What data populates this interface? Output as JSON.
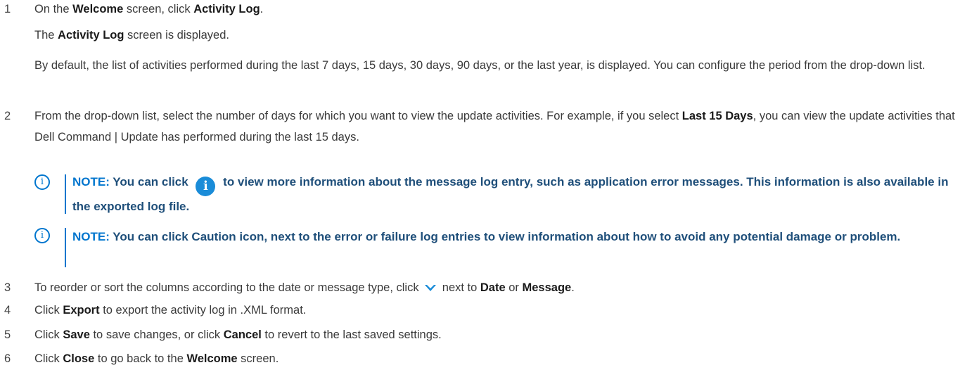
{
  "step1": {
    "num": "1",
    "pre": "On the ",
    "b1": "Welcome",
    "mid": " screen, click ",
    "b2": "Activity Log",
    "post": ".",
    "result_b": "Activity Log",
    "result_post": " screen is displayed.",
    "result_pre": "The ",
    "default_text": "By default, the list of activities performed during the last 7 days, 15 days, 30 days, 90 days, or the last year, is displayed. You can configure the period from the drop-down list."
  },
  "step2": {
    "num": "2",
    "pre": "From the drop-down list, select the number of days for which you want to view the update activities. For example, if you select ",
    "b": "Last 15 Days",
    "post": ", you can view the update activities that Dell Command | Update has performed during the last 15 days."
  },
  "note1": {
    "label": "NOTE:",
    "pre": " You can click ",
    "post": " to view more information about the message log entry, such as application error messages. This information is also available in the exported log file.",
    "icon_glyph": "i"
  },
  "note2": {
    "label": "NOTE:",
    "text": " You can click Caution icon, next to the error or failure log entries to view information about how to avoid any potential damage or problem.",
    "icon_glyph": "i"
  },
  "step3": {
    "num": "3",
    "pre": "To reorder or sort the columns according to the date or message type, click ",
    "mid": " next to ",
    "b1": "Date",
    "or": " or ",
    "b2": "Message",
    "post": "."
  },
  "step4": {
    "num": "4",
    "pre": "Click ",
    "b": "Export",
    "post": " to export the activity log in .XML format."
  },
  "step5": {
    "num": "5",
    "pre": "Click ",
    "b1": "Save",
    "mid": " to save changes, or click ",
    "b2": "Cancel",
    "post": " to revert to the last saved settings."
  },
  "step6": {
    "num": "6",
    "pre": "Click ",
    "b1": "Close",
    "mid": " to go back to the ",
    "b2": "Welcome",
    "post": " screen."
  },
  "colors": {
    "accent": "#0076ce",
    "info_icon": "#1a8cd8",
    "text": "#3a3a3a"
  }
}
